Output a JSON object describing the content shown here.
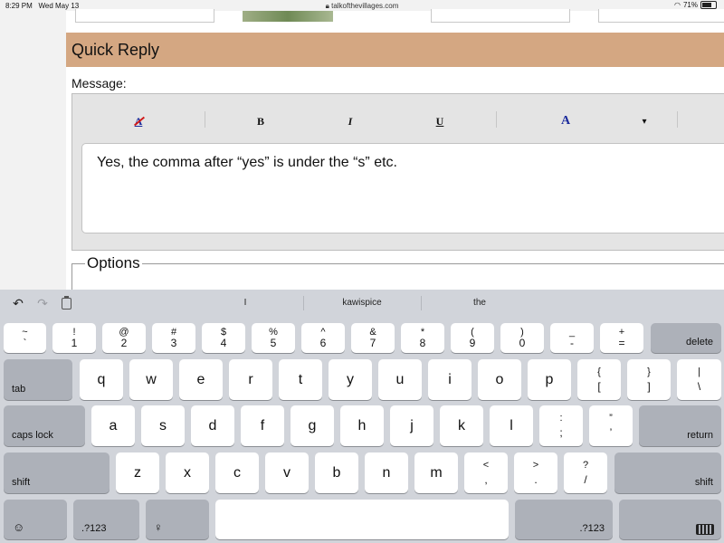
{
  "status_bar": {
    "time": "8:29 PM",
    "date": "Wed May 13",
    "url": "talkofthevillages.com",
    "battery": "71%",
    "battery_level": 0.71
  },
  "page": {
    "quick_reply_title": "Quick Reply",
    "message_label": "Message:",
    "options_legend": "Options",
    "editor_text": "Yes, the comma after “yes” is under the “s” etc.",
    "toolbar": {
      "remove_format": "A",
      "bold": "B",
      "italic": "I",
      "underline": "U",
      "font_color": "A",
      "dropdown": "▾"
    }
  },
  "keyboard": {
    "suggestions": [
      "I",
      "kawispice",
      "the"
    ],
    "keys": {
      "delete": "delete",
      "tab": "tab",
      "caps_lock": "caps lock",
      "return": "return",
      "shift_left": "shift",
      "shift_right": "shift",
      "numbers_left": ".?123",
      "numbers_right": ".?123"
    }
  },
  "colors": {
    "quick_reply_bar": "#d4a782",
    "keyboard_bg": "#d1d4da",
    "font_color_icon": "#1a2a9c",
    "remove_format_slash": "#d11a1a"
  }
}
